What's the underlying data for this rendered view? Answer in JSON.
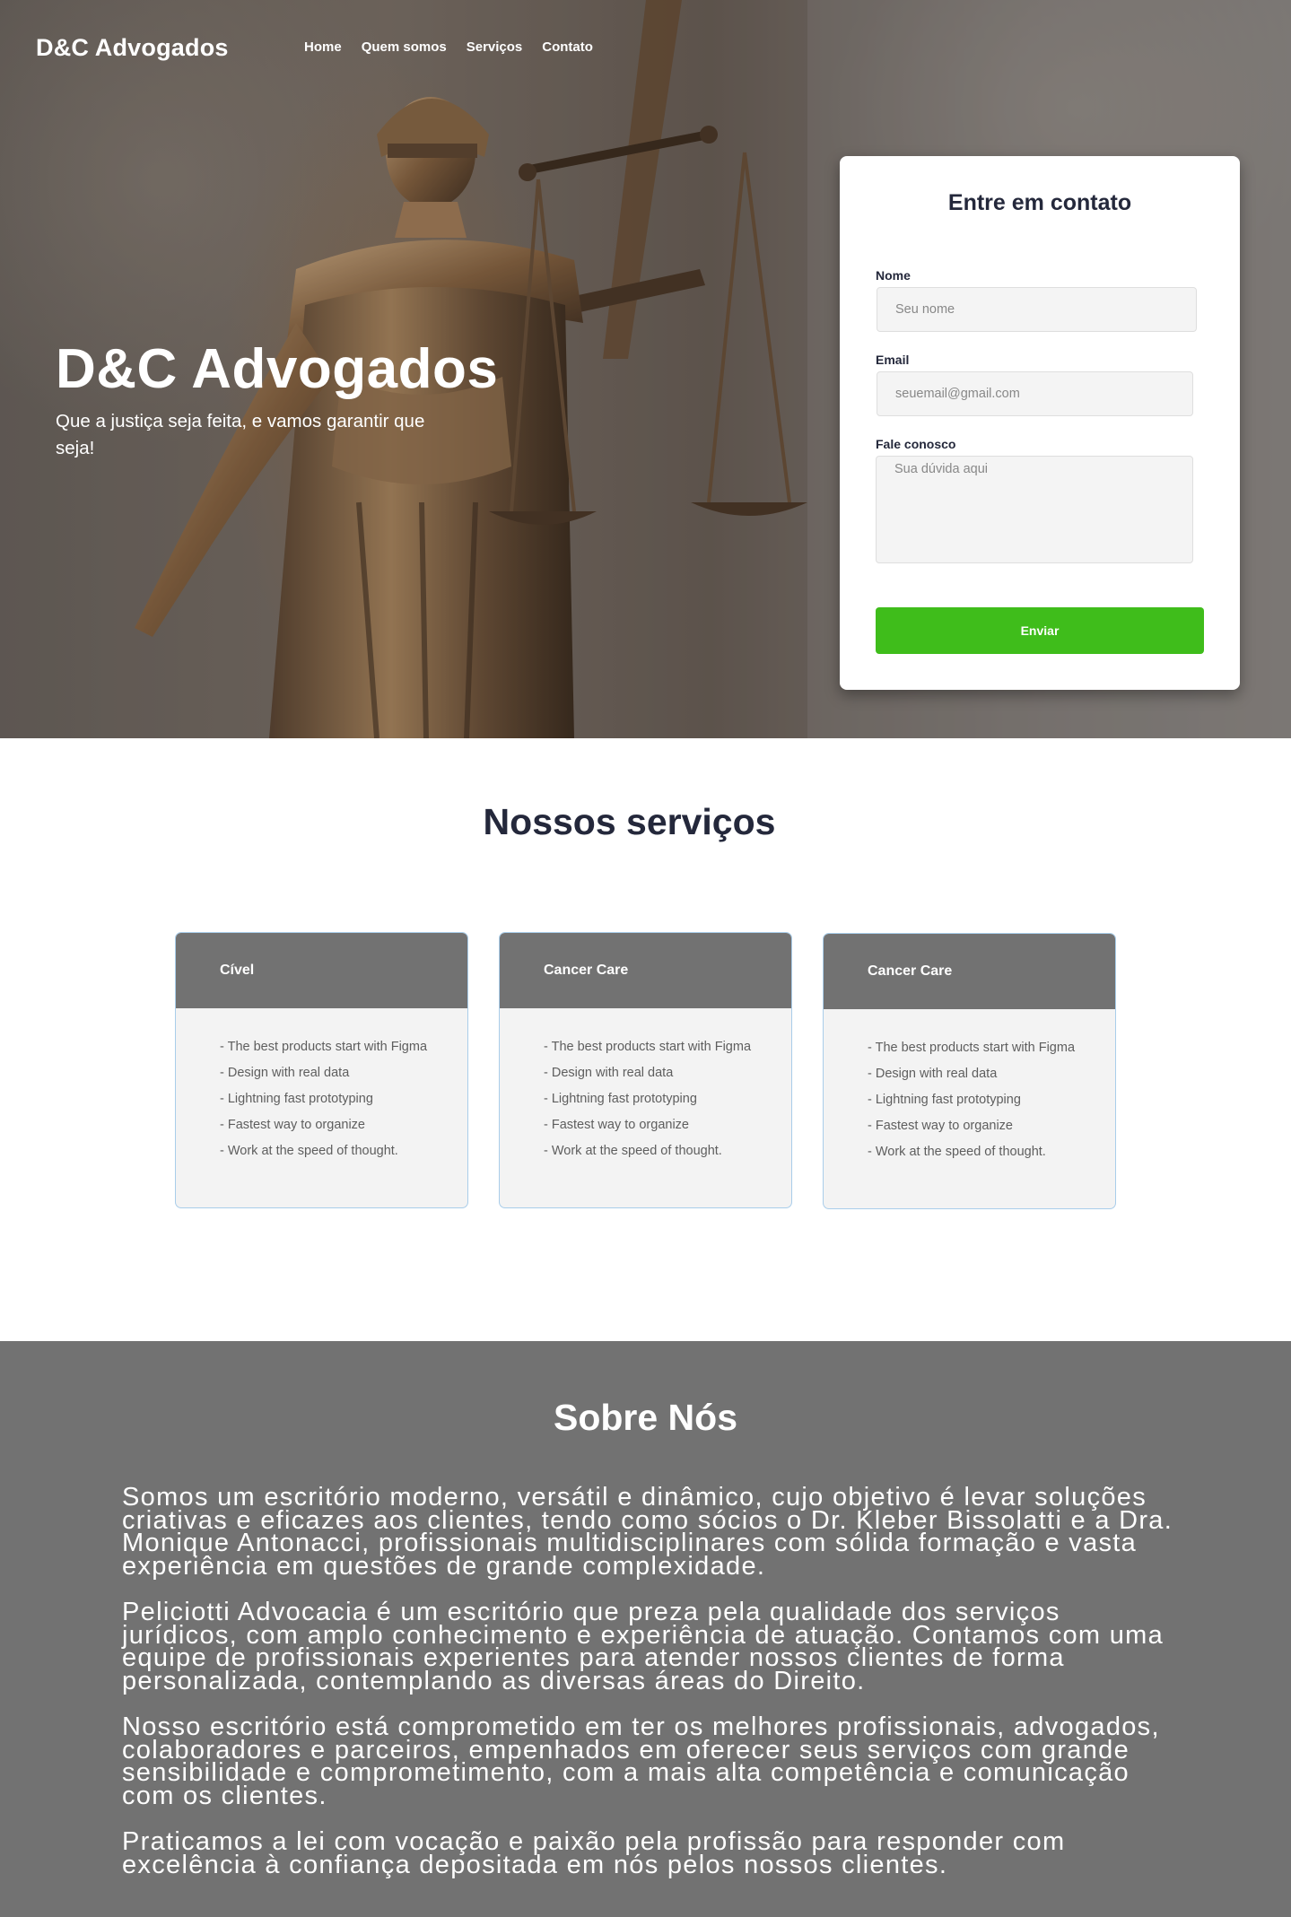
{
  "header": {
    "brand": "D&C Advogados",
    "nav": [
      "Home",
      "Quem somos",
      "Serviços",
      "Contato"
    ]
  },
  "hero": {
    "title": "D&C Advogados",
    "subtitle": "Que a justiça seja feita, e vamos garantir que seja!"
  },
  "contact": {
    "title": "Entre em contato",
    "name_label": "Nome",
    "name_placeholder": "Seu nome",
    "email_label": "Email",
    "email_placeholder": "seuemail@gmail.com",
    "message_label": "Fale conosco",
    "message_placeholder": "Sua dúvida aqui",
    "submit_label": "Enviar",
    "submit_color": "#3fbd1b"
  },
  "services": {
    "title": "Nossos serviços",
    "cards": [
      {
        "title": "Cível",
        "items": [
          "-  The best products start with Figma",
          "- Design with real data",
          "- Lightning fast prototyping",
          "- Fastest way to organize",
          "- Work at the speed of thought."
        ]
      },
      {
        "title": "Cancer Care",
        "items": [
          "-  The best products start with Figma",
          "- Design with real data",
          "- Lightning fast prototyping",
          "- Fastest way to organize",
          "- Work at the speed of thought."
        ]
      },
      {
        "title": "Cancer Care",
        "items": [
          "-  The best products start with Figma",
          "- Design with real data",
          "- Lightning fast prototyping",
          "- Fastest way to organize",
          "- Work at the speed of thought."
        ]
      }
    ]
  },
  "about": {
    "title": "Sobre Nós",
    "paragraphs": [
      "Somos um  escritório moderno, versátil e dinâmico, cujo objetivo é levar soluções criativas e eficazes aos clientes, tendo como sócios o Dr. Kleber Bissolatti e a Dra. Monique Antonacci, profissionais multidisciplinares com sólida formação e vasta experiência em questões de grande complexidade.",
      "Peliciotti Advocacia é um escritório que preza pela qualidade dos serviços jurídicos, com amplo conhecimento e experiência de atuação. Contamos com uma equipe de profissionais experientes para atender nossos clientes de forma personalizada, contemplando as diversas áreas do Direito.",
      "Nosso escritório está comprometido em ter os melhores profissionais, advogados, colaboradores e parceiros, empenhados em oferecer seus serviços com grande sensibilidade e comprometimento, com a mais alta competência e comunicação com os clientes.",
      "Praticamos a lei com vocação e paixão pela profissão para responder com excelência à confiança depositada em nós pelos nossos clientes."
    ],
    "background": "#727272"
  }
}
